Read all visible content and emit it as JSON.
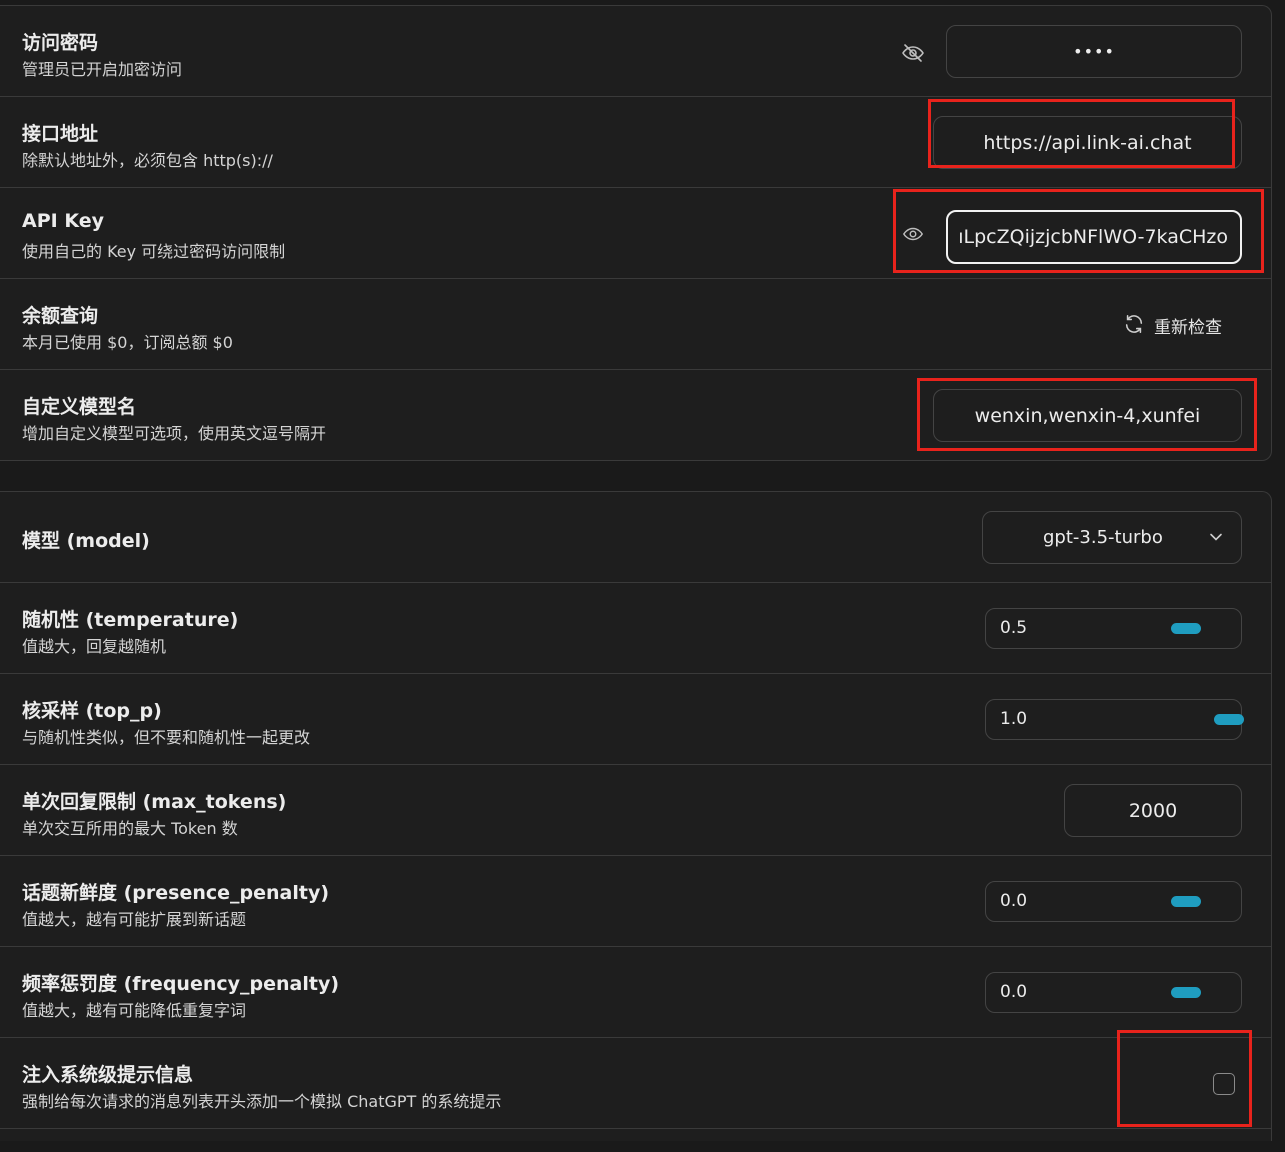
{
  "access": {
    "title": "访问密码",
    "subtitle": "管理员已开启加密访问",
    "value": "••••",
    "visibility_icon": "eye-off-icon"
  },
  "endpoint": {
    "title": "接口地址",
    "subtitle": "除默认地址外，必须包含 http(s)://",
    "value": "https://api.link-ai.chat"
  },
  "apikey": {
    "title": "API Key",
    "subtitle": "使用自己的 Key 可绕过密码访问限制",
    "value": "ıLpcZQijzjcbNFlWO-7kaCHzo",
    "visibility_icon": "eye-icon"
  },
  "balance": {
    "title": "余额查询",
    "subtitle": "本月已使用 $0，订阅总额 $0",
    "recheck_label": "重新检查",
    "recheck_icon": "refresh-icon"
  },
  "custom_models": {
    "title": "自定义模型名",
    "subtitle": "增加自定义模型可选项，使用英文逗号隔开",
    "value": "wenxin,wenxin-4,xunfei"
  },
  "model": {
    "title": "模型 (model)",
    "selected": "gpt-3.5-turbo"
  },
  "temperature": {
    "title": "随机性 (temperature)",
    "subtitle": "值越大，回复越随机",
    "value": "0.5",
    "level": 0.5
  },
  "top_p": {
    "title": "核采样 (top_p)",
    "subtitle": "与随机性类似，但不要和随机性一起更改",
    "value": "1.0",
    "level": 1.0
  },
  "max_tokens": {
    "title": "单次回复限制 (max_tokens)",
    "subtitle": "单次交互所用的最大 Token 数",
    "value": "2000"
  },
  "presence_penalty": {
    "title": "话题新鲜度 (presence_penalty)",
    "subtitle": "值越大，越有可能扩展到新话题",
    "value": "0.0",
    "level": 0.5
  },
  "frequency_penalty": {
    "title": "频率惩罚度 (frequency_penalty)",
    "subtitle": "值越大，越有可能降低重复字词",
    "value": "0.0",
    "level": 0.5
  },
  "inject_system": {
    "title": "注入系统级提示信息",
    "subtitle": "强制给每次请求的消息列表开头添加一个模拟 ChatGPT 的系统提示",
    "checked": false
  },
  "colors": {
    "accent": "#1f9dc0",
    "highlight": "#e8231c",
    "background": "#1e1e1e",
    "border": "#3a3a3a"
  }
}
